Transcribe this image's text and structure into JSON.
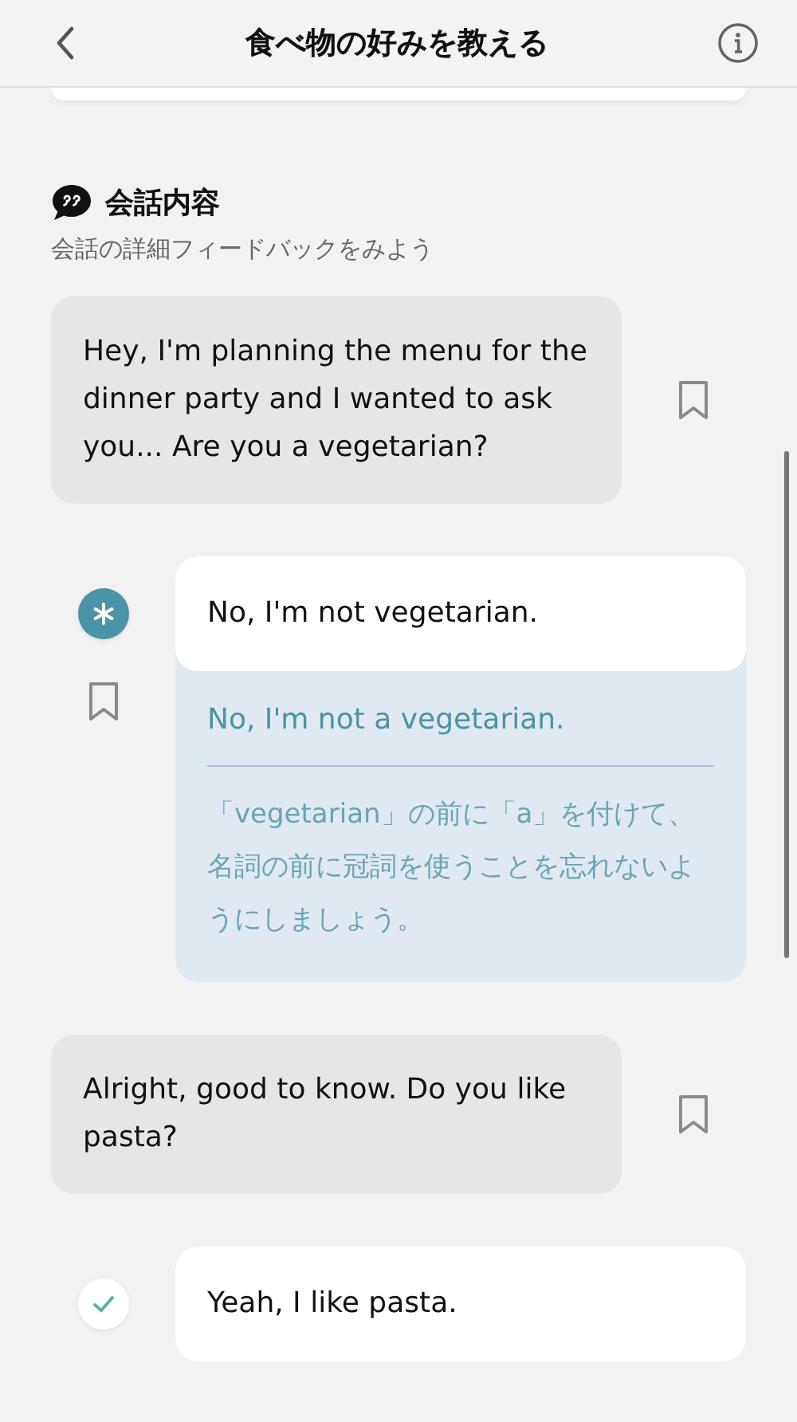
{
  "header": {
    "title": "食べ物の好みを教える"
  },
  "section": {
    "title": "会話内容",
    "subtitle": "会話の詳細フィードバックをみよう"
  },
  "messages": [
    {
      "kind": "partner",
      "text": "Hey, I'm planning the menu for the dinner party and I wanted to ask you... Are you a vegetarian?"
    },
    {
      "kind": "user",
      "correct": false,
      "text": "No, I'm not vegetarian.",
      "correction": "No, I'm not a vegetarian.",
      "explanation": "「vegetarian」の前に「a」を付けて、名詞の前に冠詞を使うことを忘れないようにしましょう。"
    },
    {
      "kind": "partner",
      "text": "Alright, good to know. Do you like pasta?"
    },
    {
      "kind": "user",
      "correct": true,
      "text": "Yeah, I like pasta."
    }
  ]
}
